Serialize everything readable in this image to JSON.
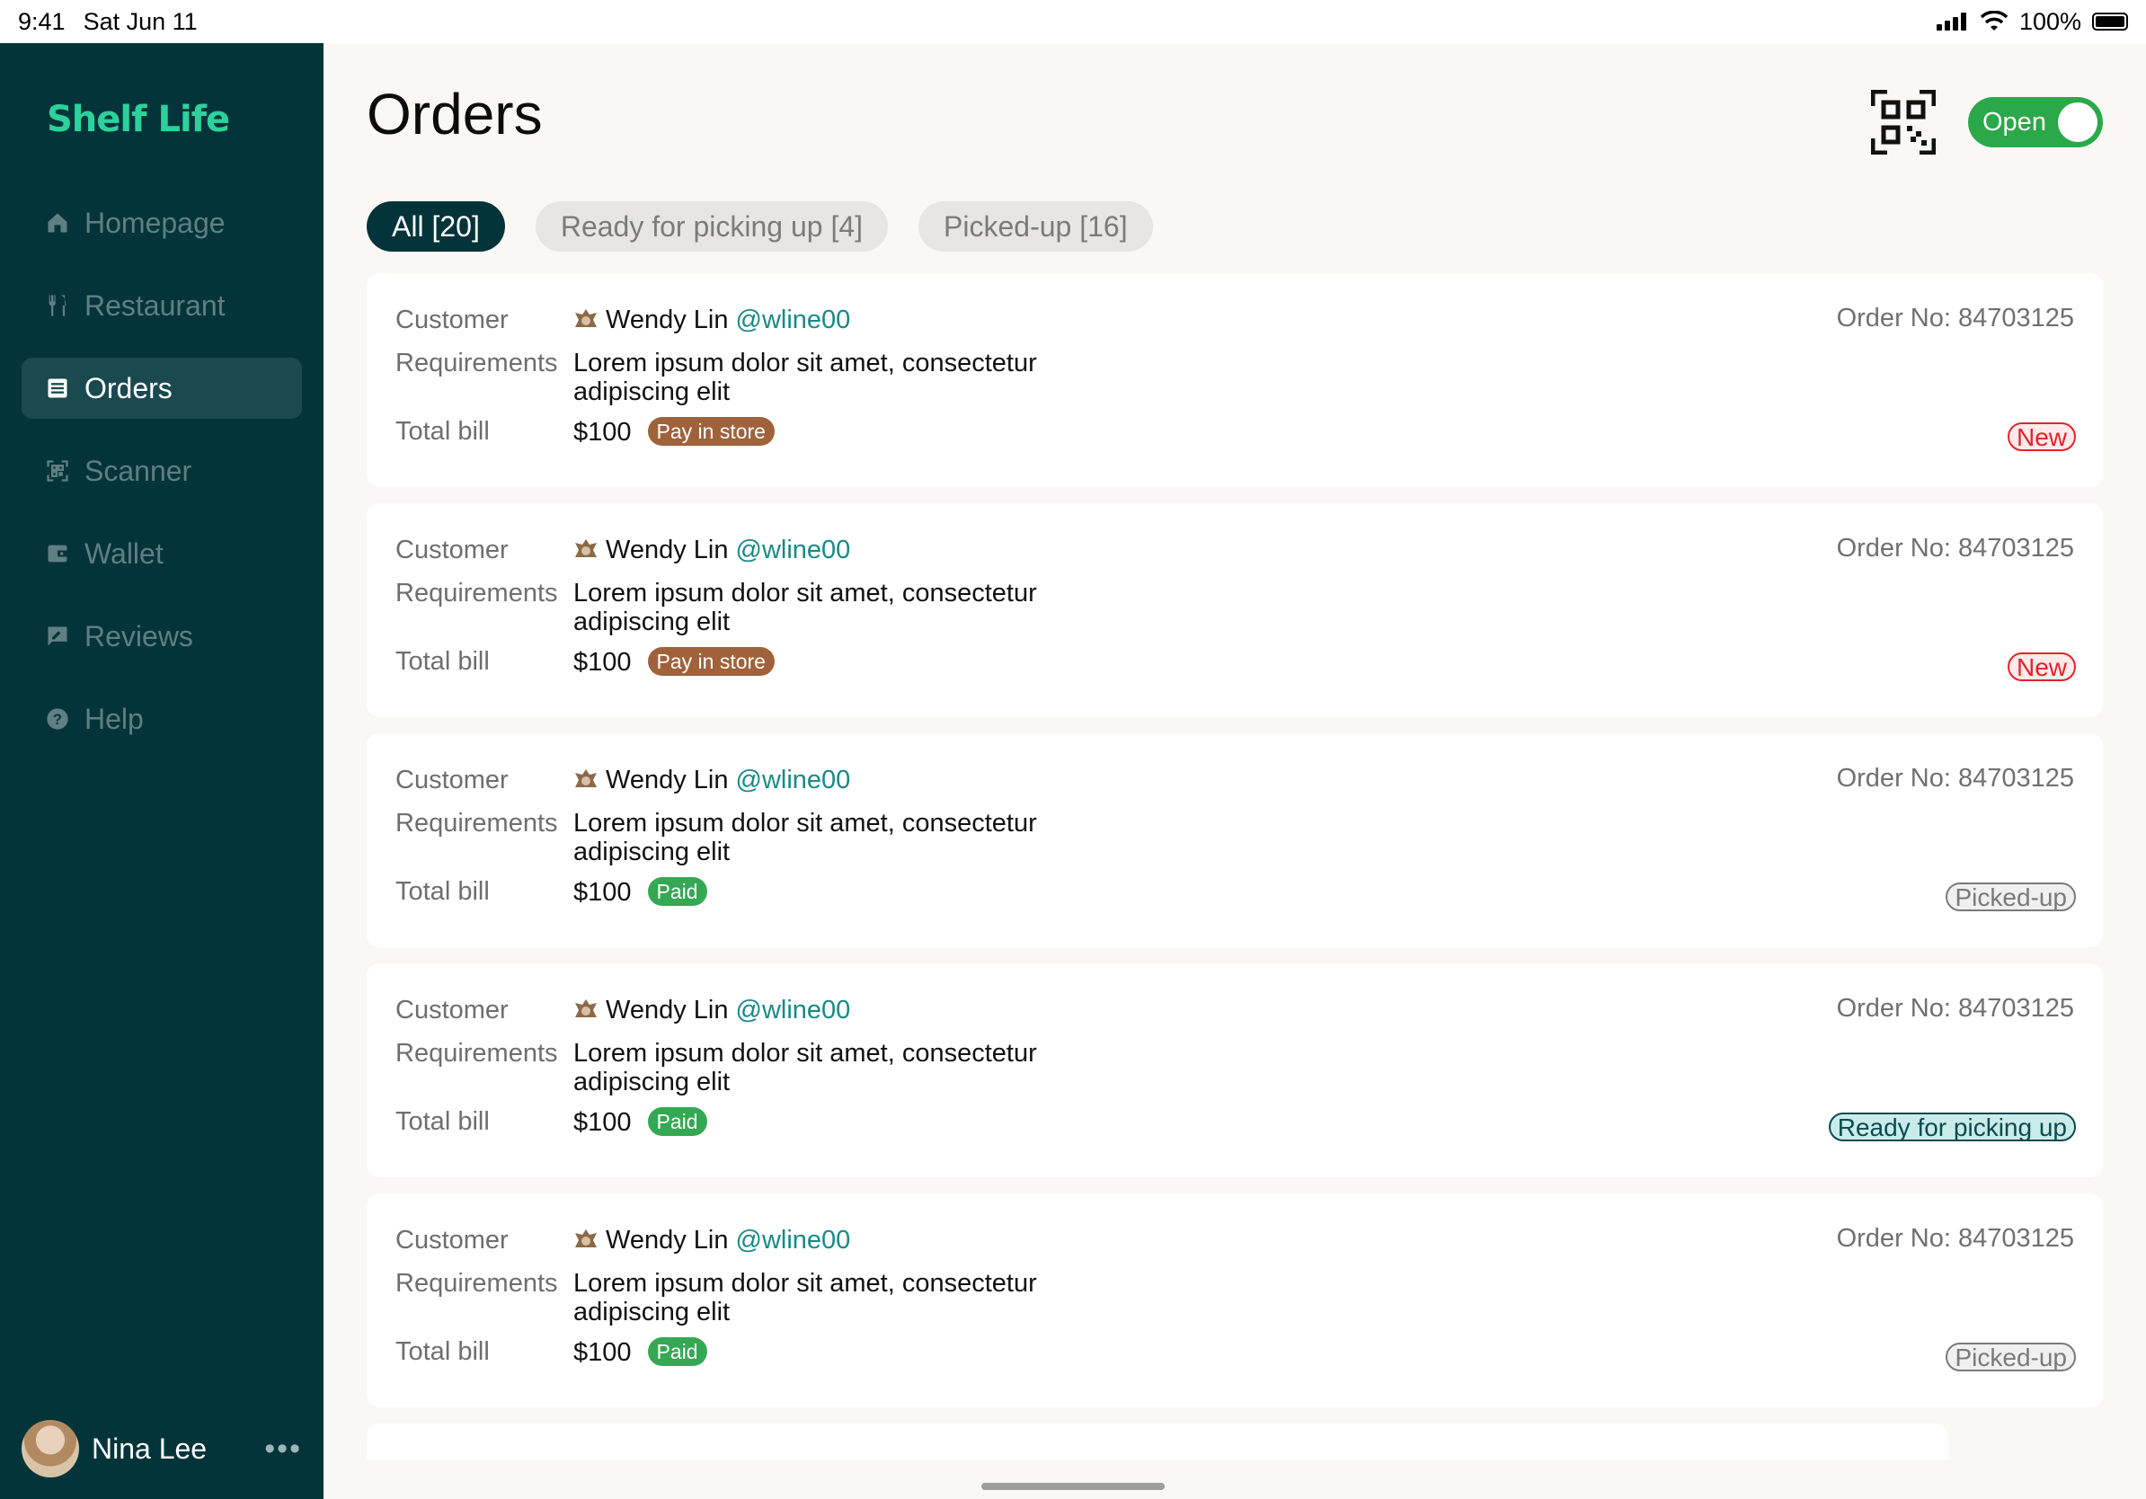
{
  "status_bar": {
    "time": "9:41",
    "date": "Sat Jun 11",
    "battery": "100%"
  },
  "sidebar": {
    "logo": "Shelf Life",
    "items": [
      {
        "label": "Homepage",
        "icon": "home-icon",
        "active": false
      },
      {
        "label": "Restaurant",
        "icon": "restaurant-icon",
        "active": false
      },
      {
        "label": "Orders",
        "icon": "orders-icon",
        "active": true
      },
      {
        "label": "Scanner",
        "icon": "scanner-icon",
        "active": false
      },
      {
        "label": "Wallet",
        "icon": "wallet-icon",
        "active": false
      },
      {
        "label": "Reviews",
        "icon": "reviews-icon",
        "active": false
      },
      {
        "label": "Help",
        "icon": "help-icon",
        "active": false
      }
    ],
    "profile": {
      "name": "Nina Lee",
      "more": "•••"
    }
  },
  "header": {
    "title": "Orders",
    "toggle_label": "Open"
  },
  "tabs": [
    {
      "label": "All [20]",
      "active": true
    },
    {
      "label": "Ready for picking up [4]",
      "active": false
    },
    {
      "label": "Picked-up [16]",
      "active": false
    }
  ],
  "labels": {
    "customer": "Customer",
    "requirements": "Requirements",
    "total": "Total bill"
  },
  "orders": [
    {
      "customer": "Wendy Lin",
      "handle": "@wline00",
      "requirements": "Lorem ipsum dolor sit amet, consectetur adipiscing elit",
      "total": "$100",
      "payment": "Pay in store",
      "order_no": "Order No: 84703125",
      "status": "New"
    },
    {
      "customer": "Wendy Lin",
      "handle": "@wline00",
      "requirements": "Lorem ipsum dolor sit amet, consectetur adipiscing elit",
      "total": "$100",
      "payment": "Pay in store",
      "order_no": "Order No: 84703125",
      "status": "New"
    },
    {
      "customer": "Wendy Lin",
      "handle": "@wline00",
      "requirements": "Lorem ipsum dolor sit amet, consectetur adipiscing elit",
      "total": "$100",
      "payment": "Paid",
      "order_no": "Order No: 84703125",
      "status": "Picked-up"
    },
    {
      "customer": "Wendy Lin",
      "handle": "@wline00",
      "requirements": "Lorem ipsum dolor sit amet, consectetur adipiscing elit",
      "total": "$100",
      "payment": "Paid",
      "order_no": "Order No: 84703125",
      "status": "Ready for picking up"
    },
    {
      "customer": "Wendy Lin",
      "handle": "@wline00",
      "requirements": "Lorem ipsum dolor sit amet, consectetur adipiscing elit",
      "total": "$100",
      "payment": "Paid",
      "order_no": "Order No: 84703125",
      "status": "Picked-up"
    }
  ],
  "colors": {
    "sidebar": "#03343a",
    "brand": "#2bd29c",
    "toggle_on": "#2aa84a",
    "pay_in_store": "#a0623a",
    "paid": "#34a853",
    "new": "#e0242a",
    "picked_up": "#7a7a7a",
    "ready": "#0b4a4f",
    "handle": "#188a86"
  }
}
